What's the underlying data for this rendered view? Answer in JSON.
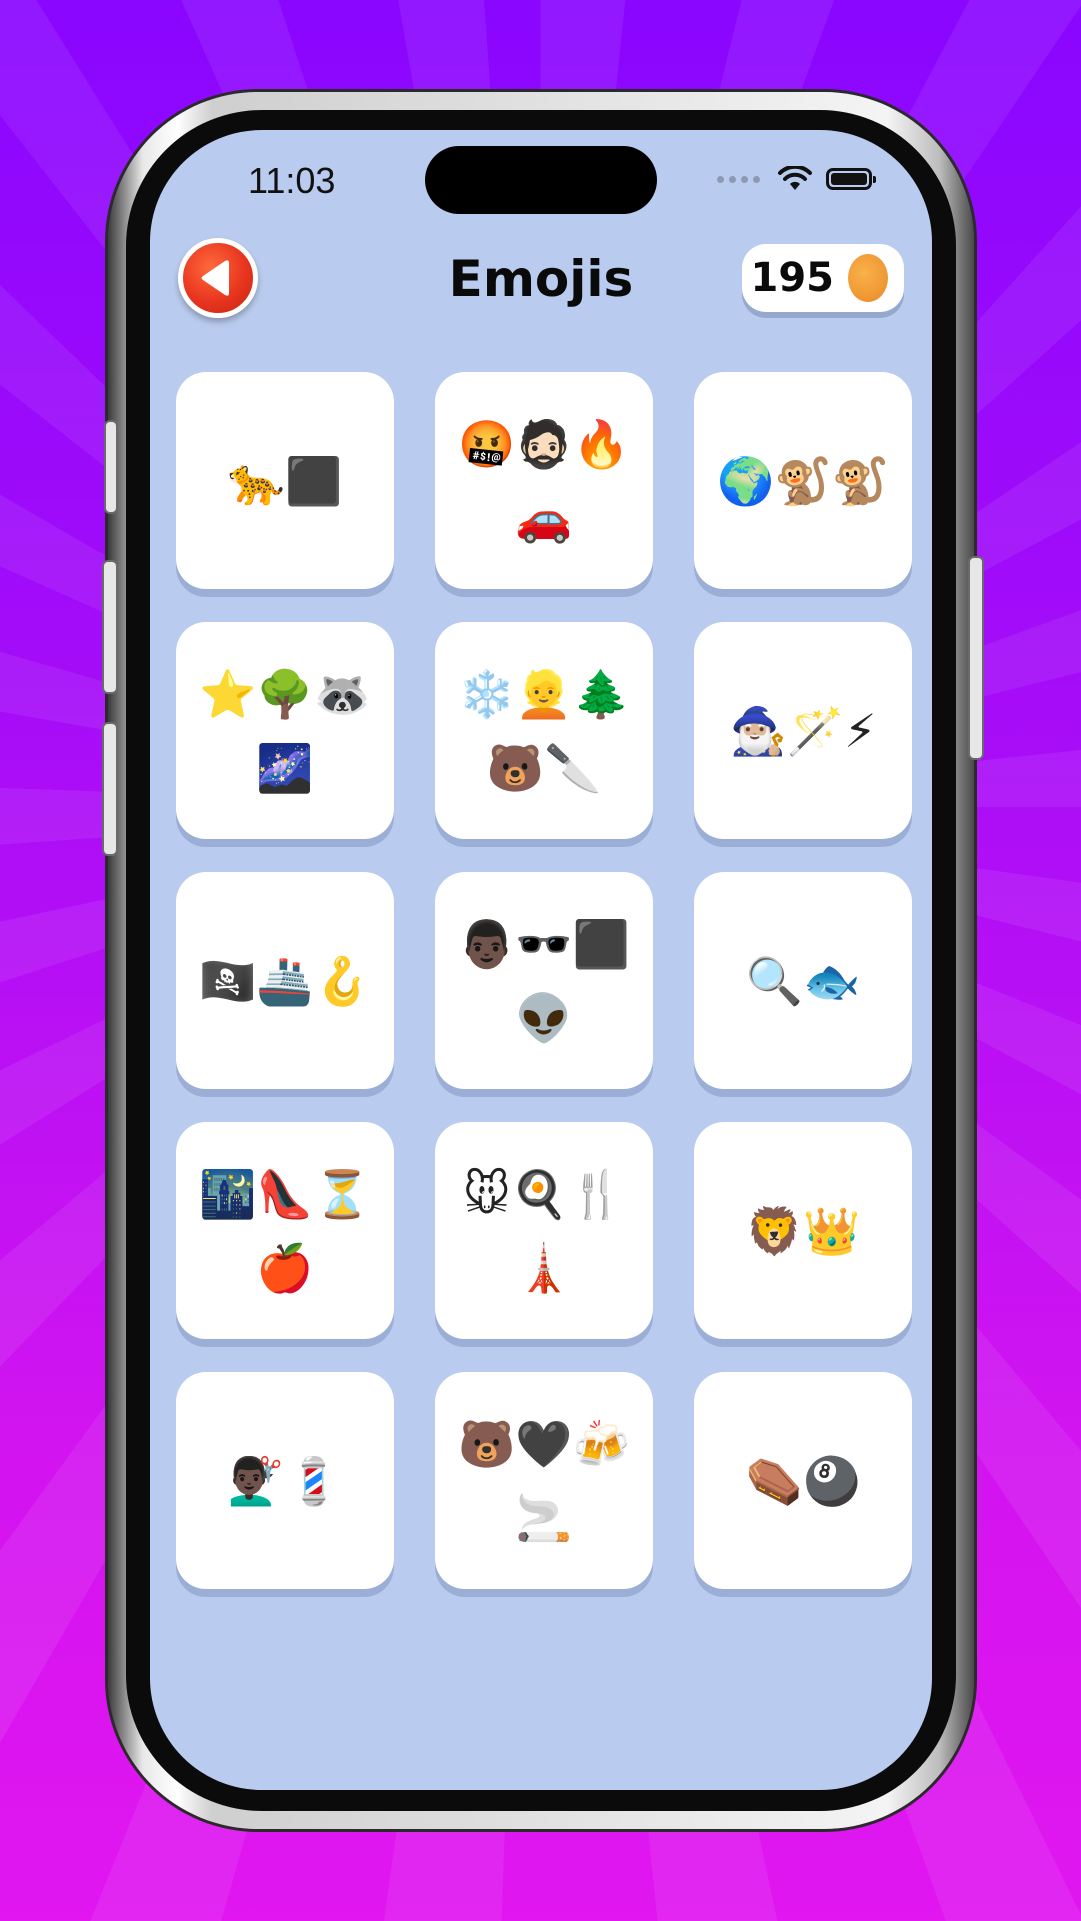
{
  "status_bar": {
    "time": "11:03"
  },
  "header": {
    "title": "Emojis",
    "coins": "195"
  },
  "colors": {
    "screen_bg": "#b9cbee",
    "back_button": "#e8351f",
    "coin": "#ee9631",
    "background": "#b10cf6"
  },
  "puzzles": [
    {
      "emojis": "🐆⬛"
    },
    {
      "emojis": "🤬🧔🏻🔥🚗"
    },
    {
      "emojis": "🌍🐒🐒"
    },
    {
      "emojis": "⭐🌳🦝🌌"
    },
    {
      "emojis": "❄️👱🌲🐻🔪"
    },
    {
      "emojis": "🧙🏼‍♂️🪄⚡"
    },
    {
      "emojis": "🏴‍☠️🚢🪝"
    },
    {
      "emojis": "👨🏿🕶️⬛👽"
    },
    {
      "emojis": "🔍🐟"
    },
    {
      "emojis": "🌃👠⏳🍎"
    },
    {
      "emojis": "🐭🍳🍴🗼"
    },
    {
      "emojis": "🦁👑"
    },
    {
      "emojis": "💇🏿‍♂️💈"
    },
    {
      "emojis": "🐻🖤🍻🚬"
    },
    {
      "emojis": "⚰️🎱"
    }
  ]
}
